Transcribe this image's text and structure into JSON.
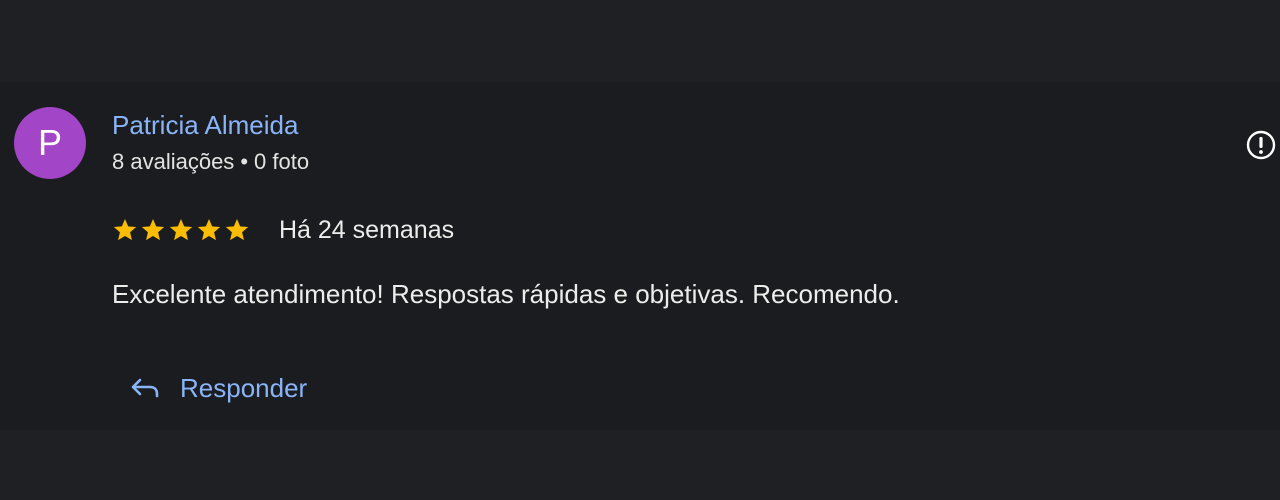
{
  "review": {
    "author": {
      "initial": "P",
      "name": "Patricia Almeida",
      "reviews_count": "8 avaliações",
      "separator": "•",
      "photos_count": "0 foto",
      "avatar_color": "#a245c6"
    },
    "rating": 5,
    "max_rating": 5,
    "time_ago": "Há 24 semanas",
    "text": "Excelente atendimento! Respostas rápidas e objetivas. Recomendo.",
    "info_icon": "info-circle-icon"
  },
  "actions": {
    "reply_label": "Responder",
    "reply_icon": "reply-arrow-icon"
  },
  "colors": {
    "background": "#1f2023",
    "card": "#1b1c1f",
    "link": "#8ab4f8",
    "star": "#fbbc04",
    "text": "#ececec"
  }
}
